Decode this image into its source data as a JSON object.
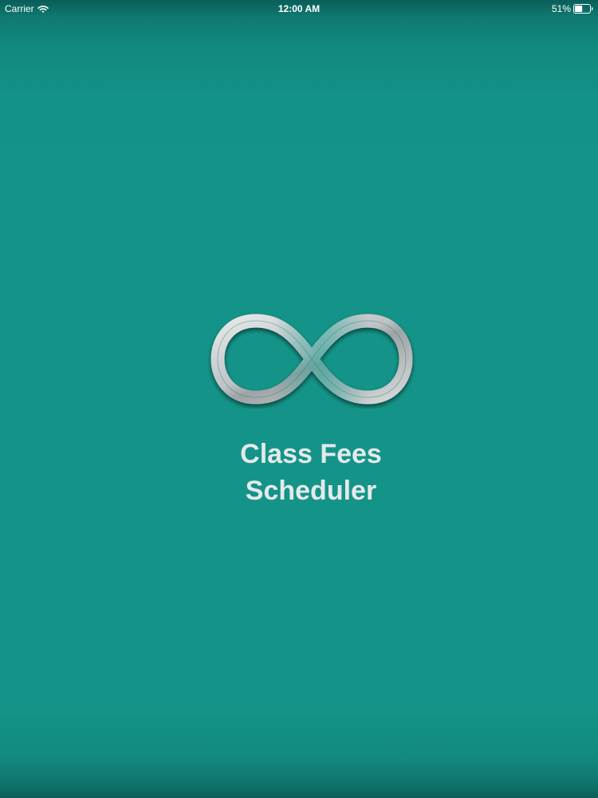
{
  "status_bar": {
    "carrier": "Carrier",
    "time": "12:00 AM",
    "battery_percent": "51%",
    "battery_level": 0.51,
    "wifi_icon": "wifi-icon",
    "battery_icon": "battery-icon"
  },
  "splash": {
    "logo_icon": "infinity-logo-icon",
    "title_line1": "Class Fees",
    "title_line2": "Scheduler"
  },
  "colors": {
    "background": "#149488",
    "title_text": "#e4e9ea",
    "logo_silver": "#c9cdcf"
  }
}
